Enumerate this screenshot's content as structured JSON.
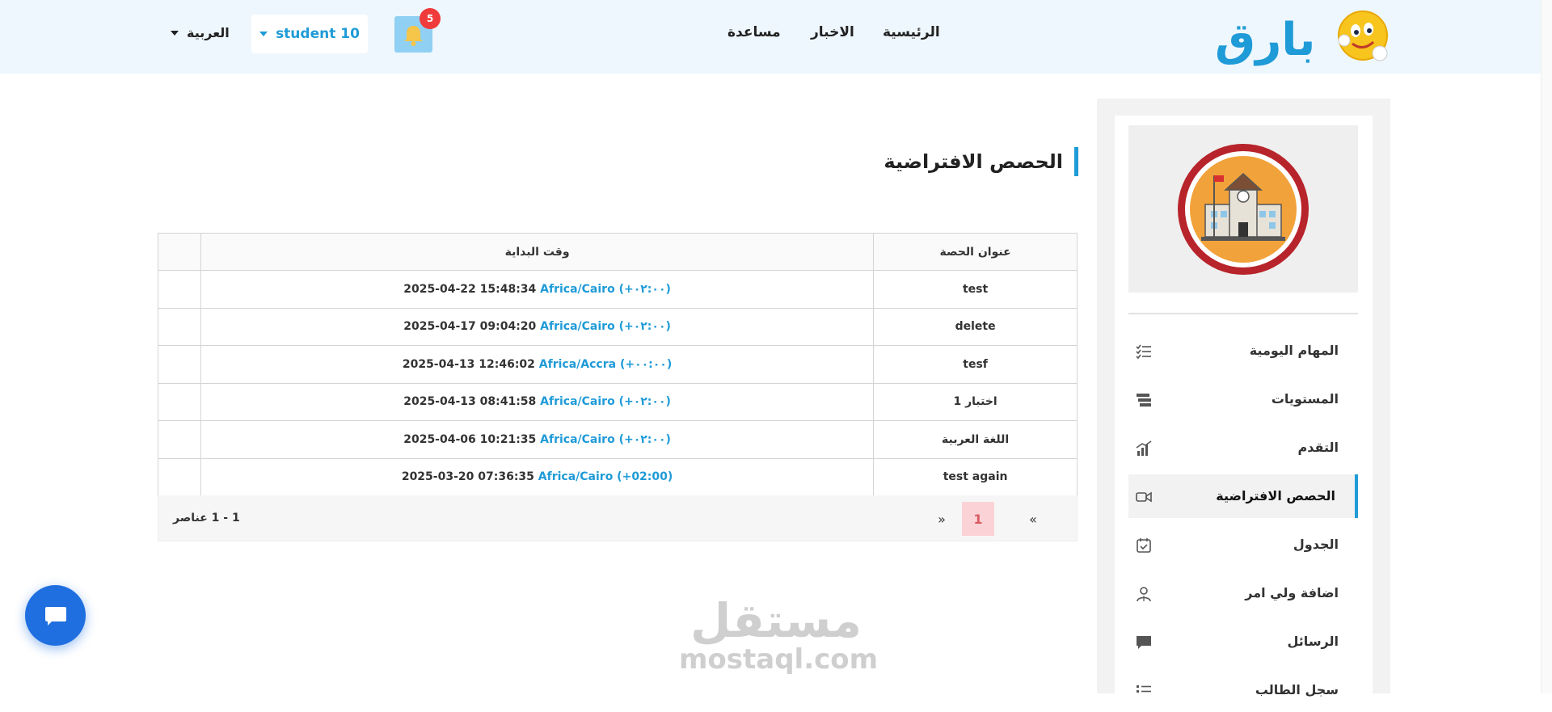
{
  "header": {
    "logo_text": "بارق",
    "nav": {
      "home": "الرئيسية",
      "news": "الاخبار",
      "help": "مساعدة"
    },
    "notifications_count": "5",
    "user_label": "student 10",
    "language_label": "العربية"
  },
  "sidebar": {
    "items": [
      {
        "label": "المهام اليومية",
        "icon": "checklist-icon"
      },
      {
        "label": "المستويات",
        "icon": "levels-icon"
      },
      {
        "label": "التقدم",
        "icon": "progress-chart-icon"
      },
      {
        "label": "الحصص الافتراضية",
        "icon": "video-camera-icon",
        "active": true
      },
      {
        "label": "الجدول",
        "icon": "calendar-check-icon"
      },
      {
        "label": "اضافة ولي امر",
        "icon": "guardian-icon"
      },
      {
        "label": "الرسائل",
        "icon": "message-icon"
      },
      {
        "label": "سجل الطالب",
        "icon": "list-icon"
      }
    ]
  },
  "main": {
    "page_title": "الحصص الافتراضية",
    "table": {
      "columns": {
        "title": "عنوان الحصة",
        "start_time": "وقت البداية"
      },
      "rows": [
        {
          "title": "test",
          "datetime": "2025-04-22 15:48:34",
          "timezone": "Africa/Cairo (+٠٢:٠٠)"
        },
        {
          "title": "delete",
          "datetime": "2025-04-17 09:04:20",
          "timezone": "Africa/Cairo (+٠٢:٠٠)"
        },
        {
          "title": "tesf",
          "datetime": "2025-04-13 12:46:02",
          "timezone": "Africa/Accra (+٠٠:٠٠)"
        },
        {
          "title": "اختبار 1",
          "datetime": "2025-04-13 08:41:58",
          "timezone": "Africa/Cairo (+٠٢:٠٠)"
        },
        {
          "title": "اللغة العربية",
          "datetime": "2025-04-06 10:21:35",
          "timezone": "Africa/Cairo (+٠٢:٠٠)"
        },
        {
          "title": "test again",
          "datetime": "2025-03-20 07:36:35",
          "timezone": "Africa/Cairo (+02:00)"
        }
      ]
    },
    "pagination": {
      "prev": "«",
      "current": "1",
      "next": "»",
      "info": "1 - 1 عناصر"
    }
  },
  "watermark": {
    "arabic": "مستقل",
    "latin": "mostaql.com"
  },
  "colors": {
    "accent": "#1f9bd7",
    "header_bg": "#eef7fd",
    "badge": "#ef3b3b",
    "chat": "#1f6fe0"
  }
}
